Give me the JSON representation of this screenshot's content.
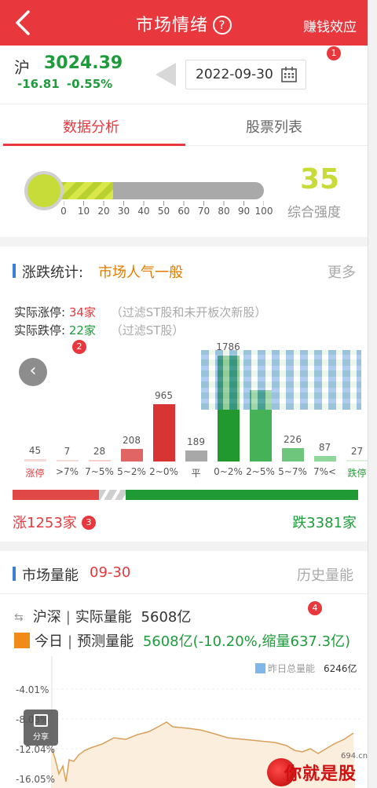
{
  "header": {
    "title": "市场情绪",
    "help_symbol": "?",
    "right_label": "赚钱效应"
  },
  "index": {
    "name": "沪",
    "value": "3024.39",
    "change": "-16.81",
    "change_pct": "-0.55%",
    "date": "2022-09-30"
  },
  "badges": [
    "1",
    "2",
    "3",
    "4"
  ],
  "tabs": [
    {
      "label": "数据分析",
      "active": true
    },
    {
      "label": "股票列表",
      "active": false
    }
  ],
  "gauge": {
    "value": 35,
    "fill_fraction": 0.35,
    "score": "35",
    "label": "综合强度",
    "ticks": [
      "0",
      "10",
      "20",
      "30",
      "40",
      "50",
      "60",
      "70",
      "80",
      "90",
      "100"
    ]
  },
  "stats": {
    "title": "涨跌统计:",
    "sentiment": "市场人气一般",
    "more": "更多",
    "limit_up_label": "实际涨停:",
    "limit_up_value": "34家",
    "limit_up_note": "（过滤ST股和未开板次新股）",
    "limit_down_label": "实际跌停:",
    "limit_down_value": "22家",
    "limit_down_note": "（过滤ST股）",
    "up_total": "涨1253家",
    "down_total": "跌3381家",
    "up_fraction": 0.27
  },
  "chart_data": {
    "type": "bar",
    "categories": [
      "涨停",
      ">7%",
      "7~5%",
      "5~2%",
      "2~0%",
      "平",
      "0~2%",
      "2~5%",
      "5~7%",
      "7%<",
      "跌停"
    ],
    "values": [
      45,
      7,
      28,
      208,
      965,
      189,
      1786,
      1200,
      226,
      87,
      27
    ],
    "value_labels": [
      "45",
      "7",
      "28",
      "208",
      "965",
      "189",
      "1786",
      "",
      "226",
      "87",
      "27"
    ],
    "ylim": [
      0,
      1800
    ]
  },
  "volume": {
    "title": "市场量能",
    "date": "09-30",
    "history": "历史量能",
    "row1_market": "沪深",
    "row1_label": "实际量能",
    "row1_value": "5608亿",
    "row2_day": "今日",
    "row2_label": "预测量能",
    "row2_value": "5608亿(-10.20%,缩量637.3亿)",
    "legend_label": "昨日总量能",
    "legend_value": "6246亿",
    "y_labels": [
      "-4.01%",
      "-8.03%",
      "-12.04%",
      "-16.05%"
    ]
  },
  "share_label": "分享",
  "watermark": {
    "text": "你就是股神",
    "url": "694.cn"
  },
  "colors": {
    "red": "#e8383d",
    "green": "#1e9b3a",
    "orange": "#e07b00",
    "gauge": "#c7dc39",
    "blue": "#3b7fd6"
  }
}
